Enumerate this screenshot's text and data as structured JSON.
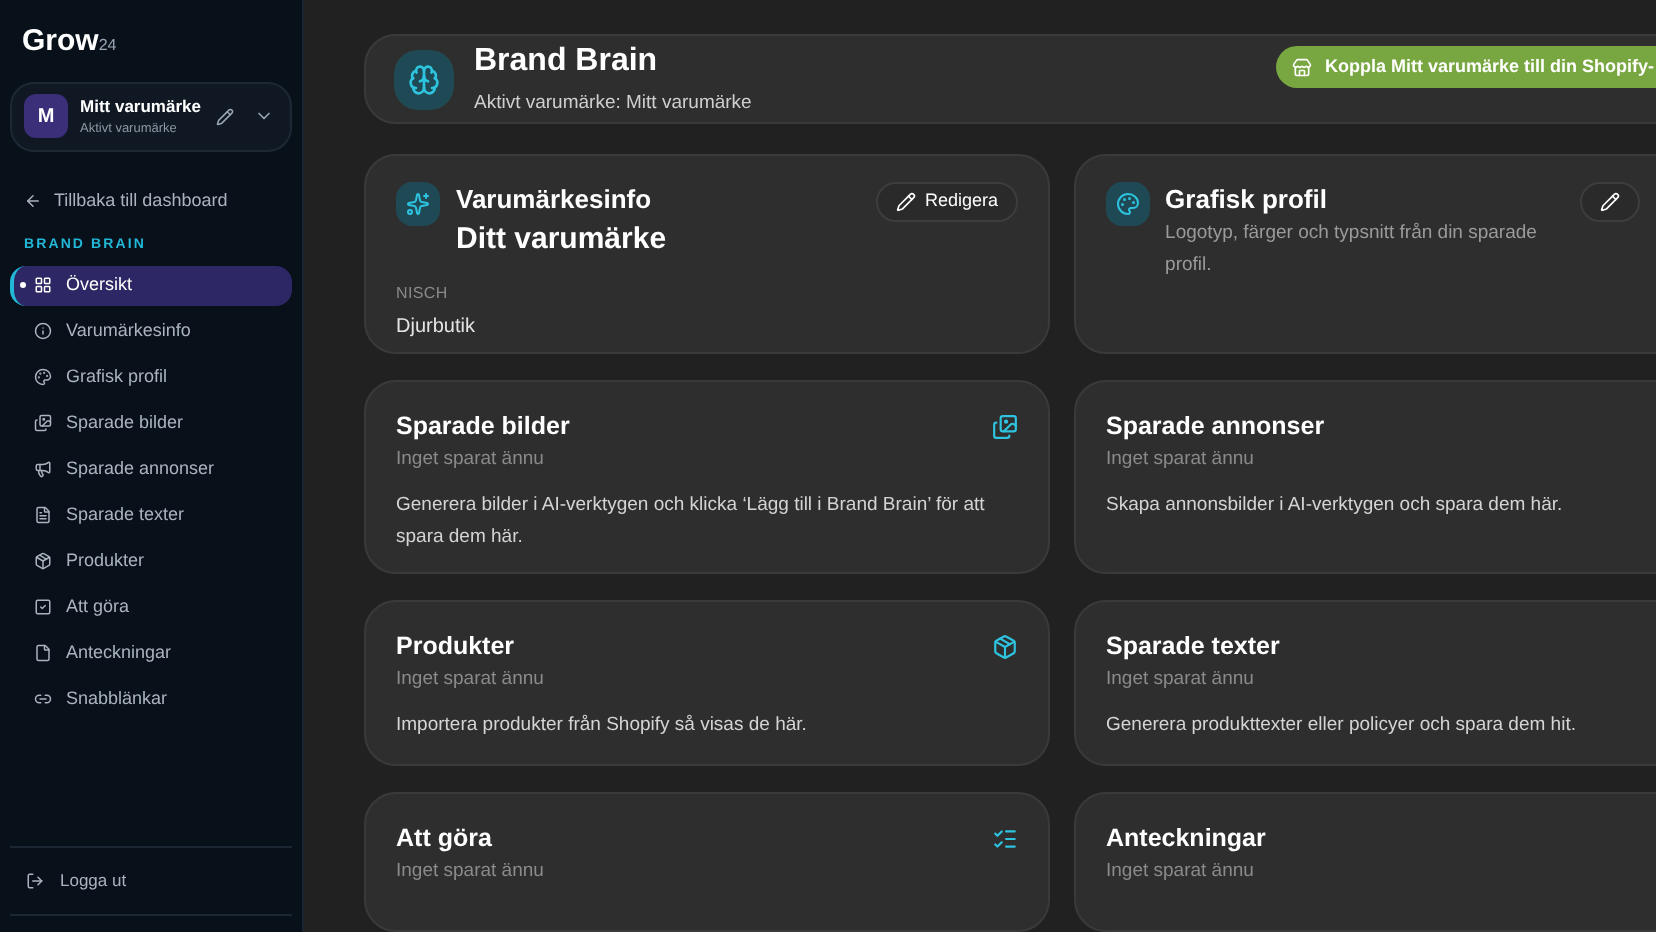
{
  "sidebar": {
    "logo": {
      "name": "Grow",
      "suffix": "24"
    },
    "brand": {
      "initial": "M",
      "name": "Mitt varumärke",
      "subtitle": "Aktivt varumärke"
    },
    "back_link": "Tillbaka till dashboard",
    "section_label": "BRAND BRAIN",
    "items": [
      {
        "label": "Översikt",
        "selected": true
      },
      {
        "label": "Varumärkesinfo",
        "selected": false
      },
      {
        "label": "Grafisk profil",
        "selected": false
      },
      {
        "label": "Sparade bilder",
        "selected": false
      },
      {
        "label": "Sparade annonser",
        "selected": false
      },
      {
        "label": "Sparade texter",
        "selected": false
      },
      {
        "label": "Produkter",
        "selected": false
      },
      {
        "label": "Att göra",
        "selected": false
      },
      {
        "label": "Anteckningar",
        "selected": false
      },
      {
        "label": "Snabblänkar",
        "selected": false
      }
    ],
    "logout": "Logga ut"
  },
  "header": {
    "title": "Brand Brain",
    "subtitle": "Aktivt varumärke: Mitt varumärke",
    "button": "Koppla Mitt varumärke till din Shopify-"
  },
  "cards": [
    {
      "kind": "info",
      "title": "Varumärkesinfo",
      "heading": "Ditt varumärke",
      "edit": "Redigera",
      "field_label": "NISCH",
      "field_value": "Djurbutik"
    },
    {
      "kind": "profile",
      "title": "Grafisk profil",
      "description": "Logotyp, färger och typsnitt från din sparade profil."
    },
    {
      "kind": "section",
      "title": "Sparade bilder",
      "status": "Inget sparat ännu",
      "description": "Generera bilder i AI-verktygen och klicka ‘Lägg till i Brand Brain’ för att spara dem här."
    },
    {
      "kind": "section",
      "title": "Sparade annonser",
      "status": "Inget sparat ännu",
      "description": "Skapa annonsbilder i AI-verktygen och spara dem här."
    },
    {
      "kind": "section",
      "title": "Produkter",
      "status": "Inget sparat ännu",
      "description": "Importera produkter från Shopify så visas de här."
    },
    {
      "kind": "section",
      "title": "Sparade texter",
      "status": "Inget sparat ännu",
      "description": "Generera produkttexter eller policyer och spara dem hit."
    },
    {
      "kind": "section",
      "title": "Att göra",
      "status": "Inget sparat ännu"
    },
    {
      "kind": "section",
      "title": "Anteckningar",
      "status": "Inget sparat ännu"
    }
  ]
}
